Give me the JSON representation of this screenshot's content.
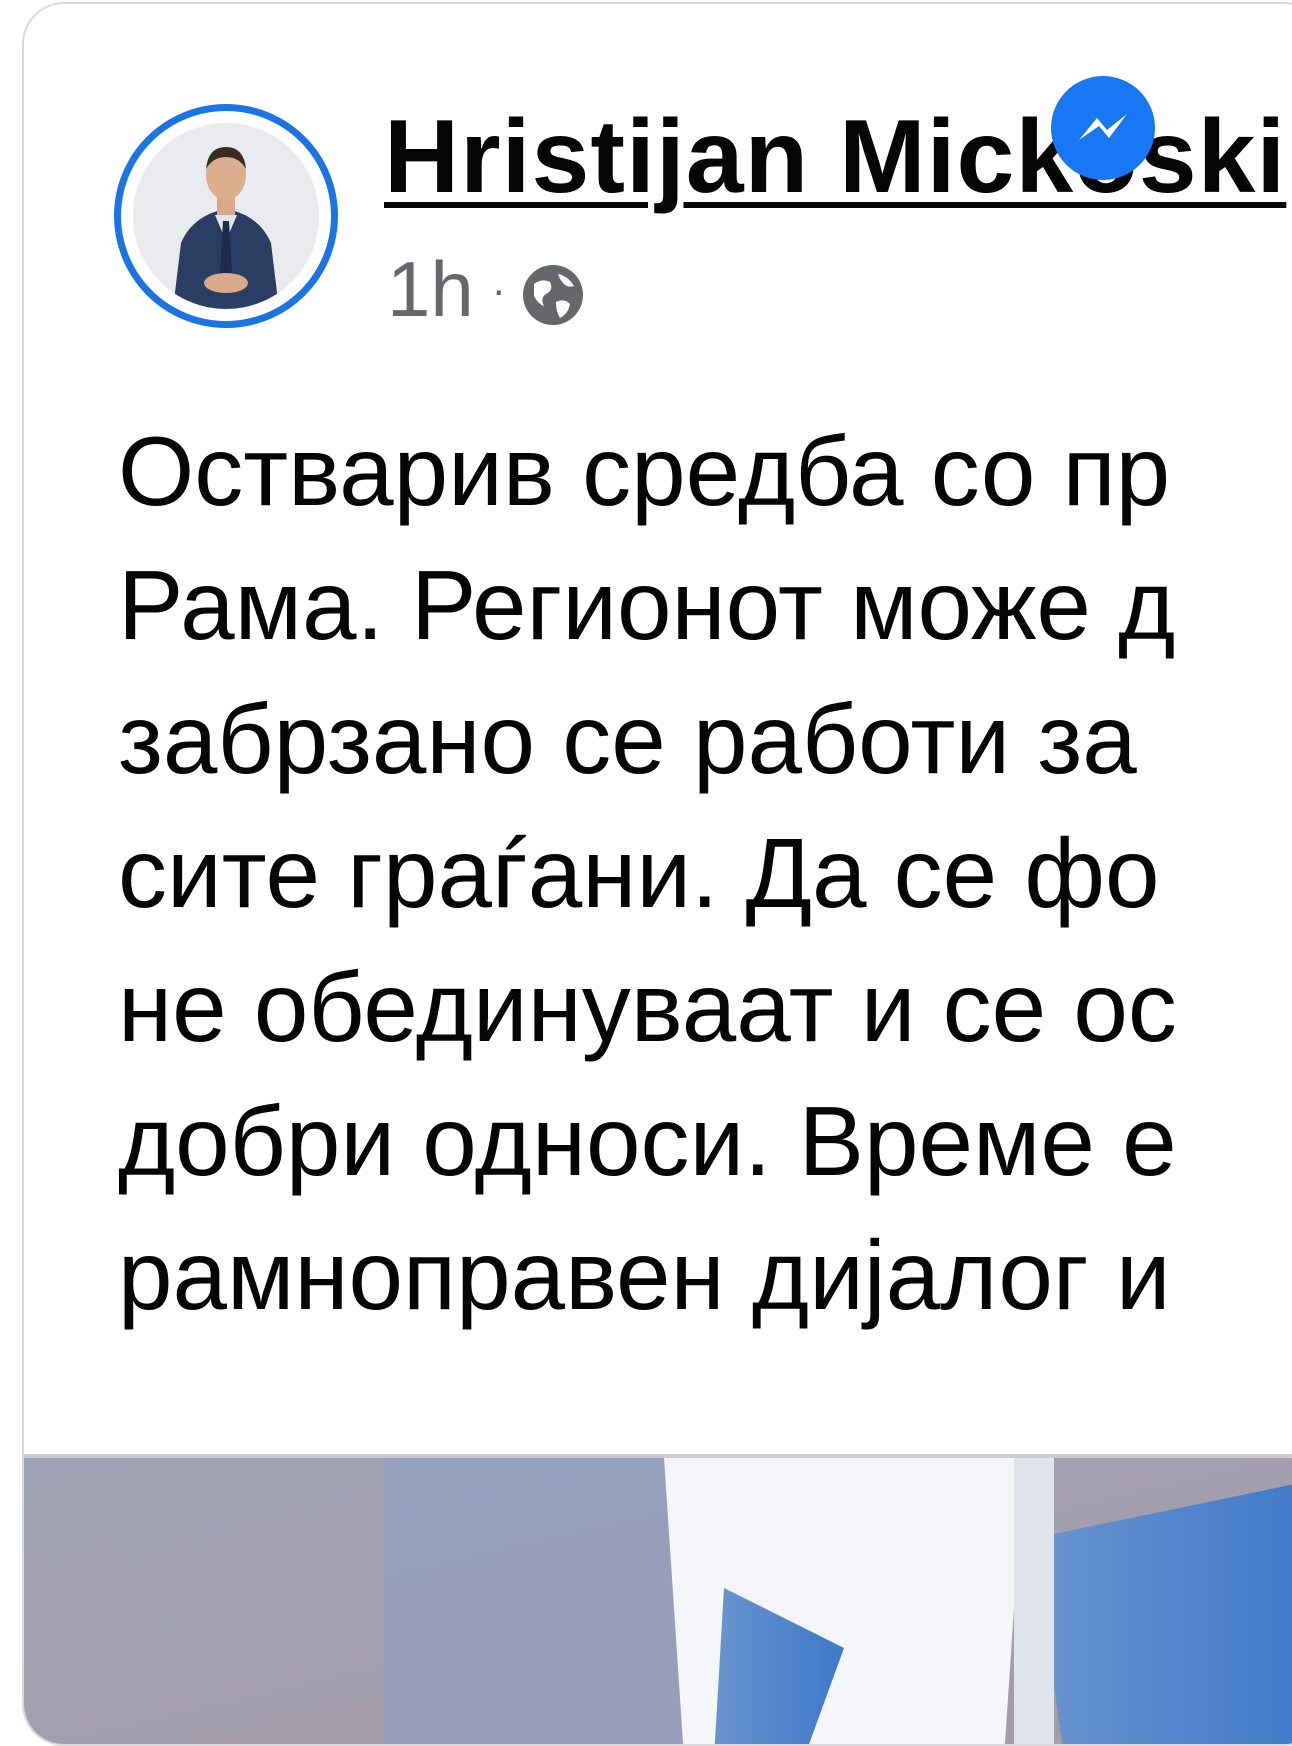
{
  "post": {
    "author": "Hristijan Mickoski",
    "timestamp": "1h",
    "separator": "·",
    "audience_icon": "globe-icon",
    "lines": [
      "Остварив средба со пр",
      "Рама. Регионот може д",
      "забрзано се работи за",
      "сите граѓани. Да се фо",
      "не обединуваат и се ос",
      "добри односи. Време е",
      "рамноправен дијалог и"
    ]
  },
  "colors": {
    "accent": "#1b74e4",
    "text": "#050505",
    "meta": "#65676b",
    "border": "#d8dadf"
  },
  "icons": {
    "badge": "messenger-icon"
  }
}
